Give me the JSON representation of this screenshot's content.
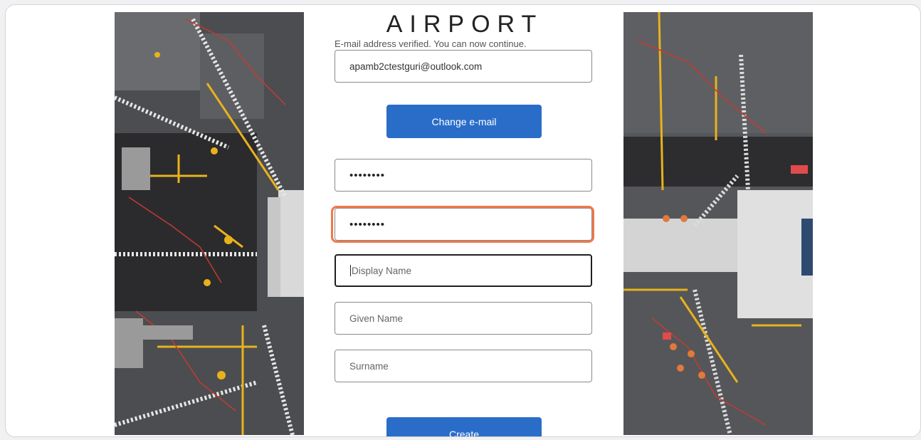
{
  "brand": {
    "logo_text": "AIRPORT"
  },
  "form": {
    "verified_message": "E-mail address verified. You can now continue.",
    "email_value": "apamb2ctestguri@outlook.com",
    "change_email_label": "Change e-mail",
    "password_value": "••••••••",
    "confirm_password_value": "••••••••",
    "display_name_placeholder": "Display Name",
    "given_name_placeholder": "Given Name",
    "surname_placeholder": "Surname",
    "create_label": "Create"
  },
  "colors": {
    "primary_button": "#2a6dc9",
    "highlight_ring": "#f0784a"
  }
}
